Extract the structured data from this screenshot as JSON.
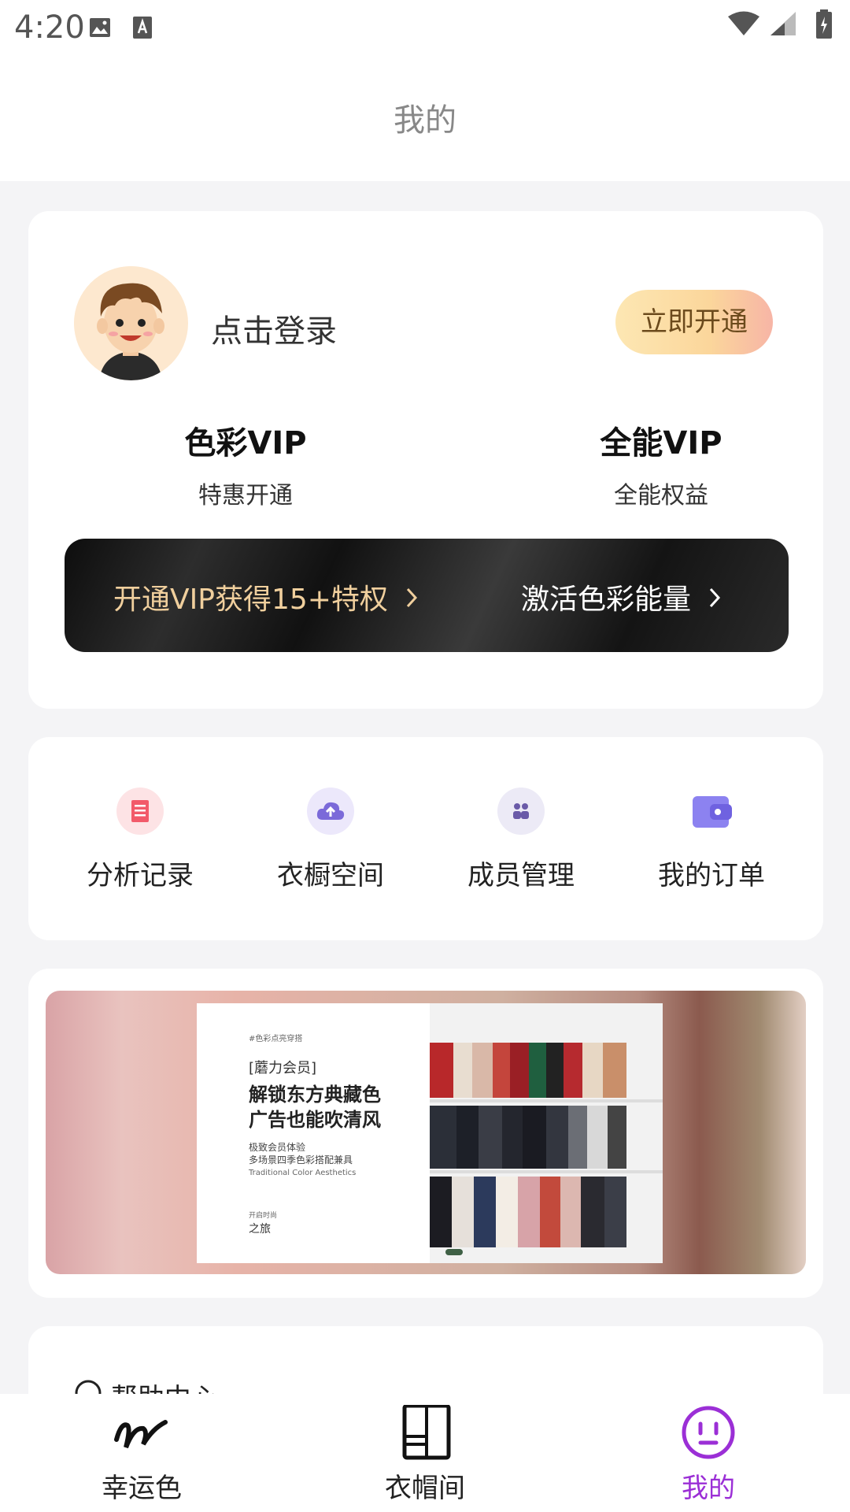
{
  "status_bar": {
    "time": "4:20"
  },
  "header": {
    "title": "我的"
  },
  "profile": {
    "login_text": "点击登录",
    "open_button": "立即开通",
    "vip_options": [
      {
        "title": "色彩VIP",
        "subtitle": "特惠开通"
      },
      {
        "title": "全能VIP",
        "subtitle": "全能权益"
      }
    ],
    "banner": {
      "left": "开通VIP获得15+特权",
      "right": "激活色彩能量"
    }
  },
  "quick_actions": [
    {
      "label": "分析记录",
      "icon": "record-book-icon",
      "color": "#f25a6a"
    },
    {
      "label": "衣橱空间",
      "icon": "cloud-upload-icon",
      "color": "#7b6ad9"
    },
    {
      "label": "成员管理",
      "icon": "members-icon",
      "color": "#6a5aa8"
    },
    {
      "label": "我的订单",
      "icon": "wallet-icon",
      "color": "#6f62e0"
    }
  ],
  "ad": {
    "tag": "#色彩点亮穿搭",
    "line1": "[蘑力会员]",
    "line2": "解锁东方典藏色",
    "line3": "广告也能吹清风",
    "line4": "极致会员体验",
    "line5": "多场景四季色彩搭配兼具",
    "line6": "Traditional Color Aesthetics",
    "line7": "开启时尚",
    "line8": "之旅"
  },
  "help": {
    "label": "帮助中心"
  },
  "bottom_nav": [
    {
      "label": "幸运色",
      "icon": "signature-icon",
      "active": false
    },
    {
      "label": "衣帽间",
      "icon": "wardrobe-icon",
      "active": false
    },
    {
      "label": "我的",
      "icon": "smiley-face-icon",
      "active": true
    }
  ],
  "colors": {
    "accent": "#9b2fd6",
    "vip_gold": "#f0cf9d"
  }
}
